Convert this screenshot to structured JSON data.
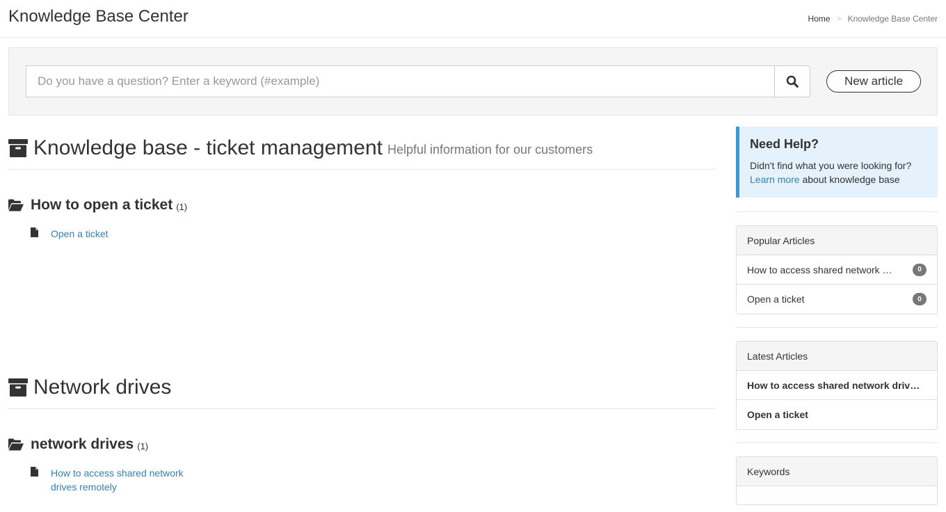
{
  "header": {
    "title": "Knowledge Base Center",
    "breadcrumb": {
      "home": "Home",
      "separator": ">",
      "current": "Knowledge Base Center"
    }
  },
  "search": {
    "placeholder": "Do you have a question? Enter a keyword (#example)",
    "value": "",
    "search_icon": "search-icon",
    "new_article_label": "New article"
  },
  "knowledge_bases": [
    {
      "title": "Knowledge base - ticket management",
      "subtitle": "Helpful information for our customers",
      "icon": "archive-icon",
      "categories": [
        {
          "title": "How to open a ticket",
          "count": "(1)",
          "icon": "folder-open-icon",
          "articles": [
            {
              "title": "Open a ticket",
              "icon": "file-icon"
            }
          ]
        }
      ]
    },
    {
      "title": "Network drives",
      "subtitle": "",
      "icon": "archive-icon",
      "categories": [
        {
          "title": "network drives",
          "count": "(1)",
          "icon": "folder-open-icon",
          "articles": [
            {
              "title": "How to access shared network drives remotely",
              "icon": "file-icon"
            }
          ]
        }
      ]
    }
  ],
  "sidebar": {
    "help": {
      "title": "Need Help?",
      "text_before": "Didn't find what you were looking for?",
      "link": "Learn more",
      "text_after": " about knowledge base"
    },
    "popular": {
      "heading": "Popular Articles",
      "items": [
        {
          "title": "How to access shared network drives remotely",
          "count": "0"
        },
        {
          "title": "Open a ticket",
          "count": "0"
        }
      ]
    },
    "latest": {
      "heading": "Latest Articles",
      "items": [
        {
          "title": "How to access shared network drives remotely"
        },
        {
          "title": "Open a ticket"
        }
      ]
    },
    "keywords": {
      "heading": "Keywords"
    }
  },
  "colors": {
    "link": "#3380b5",
    "help_accent": "#3a9ad9",
    "help_background": "#e5f1fb",
    "badge": "#777777"
  }
}
